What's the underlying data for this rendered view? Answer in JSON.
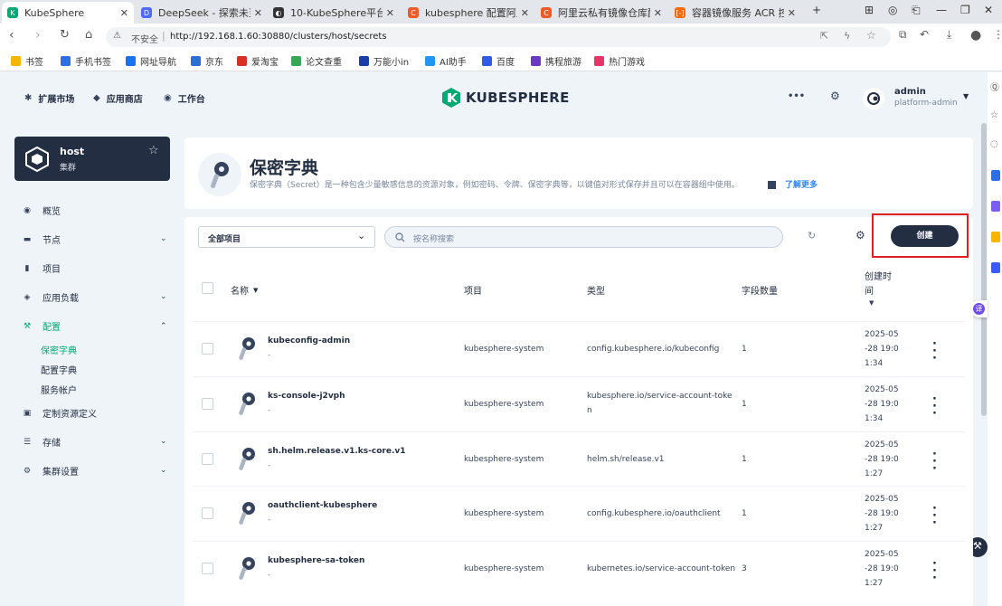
{
  "browser": {
    "tabs": [
      {
        "title": "KubeSphere",
        "active": true,
        "color": "#00aa72",
        "glyph": "K"
      },
      {
        "title": "DeepSeek - 探索未至之",
        "active": false,
        "color": "#4d6bfe",
        "glyph": "D"
      },
      {
        "title": "10-KubeSphere平台",
        "active": false,
        "color": "#333333",
        "glyph": "◐"
      },
      {
        "title": "kubesphere 配置阿里镜",
        "active": false,
        "color": "#f05a28",
        "glyph": "C"
      },
      {
        "title": "阿里云私有镜像仓库配置",
        "active": false,
        "color": "#f05a28",
        "glyph": "C"
      },
      {
        "title": "容器镜像服务 ACR 控制",
        "active": false,
        "color": "#ff6a00",
        "glyph": "[-]"
      }
    ],
    "new_tab": "+",
    "security_label": "不安全",
    "url": "http://192.168.1.60:30880/clusters/host/secrets",
    "bookmarks": [
      "书签",
      "手机书签",
      "网址导航",
      "京东",
      "爱淘宝",
      "论文查重",
      "万能小in",
      "AI助手",
      "百度",
      "携程旅游",
      "热门游戏"
    ],
    "bookmark_colors": [
      "#f5b400",
      "#2f6fe4",
      "#1a73e8",
      "#2b70d8",
      "#d93025",
      "#3aa757",
      "#1a3ea8",
      "#2196f3",
      "#2f5bea",
      "#6a38c2",
      "#e8336b"
    ]
  },
  "header": {
    "nav": [
      "扩展市场",
      "应用商店",
      "工作台"
    ],
    "logo_text": "KUBESPHERE",
    "user_name": "admin",
    "user_role": "platform-admin"
  },
  "cluster": {
    "name": "host",
    "type": "集群"
  },
  "sidebar": {
    "items": [
      {
        "label": "概览",
        "has_children": false
      },
      {
        "label": "节点",
        "has_children": true
      },
      {
        "label": "项目",
        "has_children": false
      },
      {
        "label": "应用负载",
        "has_children": true
      },
      {
        "label": "配置",
        "has_children": true,
        "expanded": true,
        "active": true
      },
      {
        "label": "定制资源定义",
        "has_children": false
      },
      {
        "label": "存储",
        "has_children": true
      },
      {
        "label": "集群设置",
        "has_children": true
      }
    ],
    "config_children": [
      {
        "label": "保密字典",
        "active": true
      },
      {
        "label": "配置字典",
        "active": false
      },
      {
        "label": "服务帐户",
        "active": false
      }
    ],
    "active_color": "#00aa72"
  },
  "page": {
    "title": "保密字典",
    "description": "保密字典（Secret）是一种包含少量敏感信息的资源对象，例如密码、令牌、保密字典等，以键值对形式保存并且可以在容器组中使用。",
    "learn_more": "了解更多"
  },
  "toolbar": {
    "project_select": "全部项目",
    "search_placeholder": "按名称搜索",
    "create_label": "创建"
  },
  "table": {
    "columns": {
      "name": "名称",
      "project": "项目",
      "type": "类型",
      "field_count": "字段数量",
      "created_line1": "创建时",
      "created_line2": "间"
    },
    "rows": [
      {
        "name": "kubeconfig-admin",
        "desc": "-",
        "project": "kubesphere-system",
        "type_line1": "config.kubesphere.io/kubeconfig",
        "type_line2": "",
        "fields": "1",
        "created": [
          "2025-05",
          "-28 19:0",
          "1:34"
        ]
      },
      {
        "name": "ks-console-j2vph",
        "desc": "-",
        "project": "kubesphere-system",
        "type_line1": "kubesphere.io/service-account-toke",
        "type_line2": "n",
        "fields": "1",
        "created": [
          "2025-05",
          "-28 19:0",
          "1:34"
        ]
      },
      {
        "name": "sh.helm.release.v1.ks-core.v1",
        "desc": "-",
        "project": "kubesphere-system",
        "type_line1": "helm.sh/release.v1",
        "type_line2": "",
        "fields": "1",
        "created": [
          "2025-05",
          "-28 19:0",
          "1:27"
        ]
      },
      {
        "name": "oauthclient-kubesphere",
        "desc": "-",
        "project": "kubesphere-system",
        "type_line1": "config.kubesphere.io/oauthclient",
        "type_line2": "",
        "fields": "1",
        "created": [
          "2025-05",
          "-28 19:0",
          "1:27"
        ]
      },
      {
        "name": "kubesphere-sa-token",
        "desc": "-",
        "project": "kubesphere-system",
        "type_line1": "kubernetes.io/service-account-token",
        "type_line2": "",
        "fields": "3",
        "created": [
          "2025-05",
          "-28 19:0",
          "1:27"
        ]
      }
    ]
  },
  "translate_badge": "译"
}
